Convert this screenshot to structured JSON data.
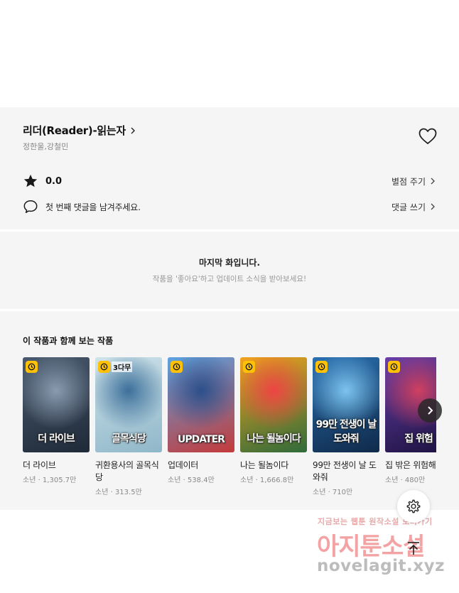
{
  "work": {
    "title": "리더(Reader)-읽는자",
    "authors": "정한울,강철민"
  },
  "rating": {
    "value": "0.0",
    "action_label": "별점 주기"
  },
  "comments": {
    "prompt": "첫 번째 댓글을 남겨주세요.",
    "action_label": "댓글 쓰기"
  },
  "notice": {
    "title": "마지막 화입니다.",
    "subtitle": "작품을 '좋아요'하고 업데이트 소식을 받아보세요!"
  },
  "recommendations": {
    "heading": "이 작품과 함께 보는 작품",
    "items": [
      {
        "name": "더 라이브",
        "meta": "소년 · 1,305.7만",
        "cover_text": "더 라이브",
        "badge": "",
        "colors": [
          "#4a5a6e",
          "#1f2a38",
          "#8a9bb0"
        ]
      },
      {
        "name": "귀환용사의 골목식당",
        "meta": "소년 · 313.5만",
        "cover_text": "골목식당",
        "badge": "3다무",
        "colors": [
          "#cfe3ea",
          "#8fb7c9",
          "#3c6f9a"
        ]
      },
      {
        "name": "업데이터",
        "meta": "소년 · 538.4만",
        "cover_text": "UPDATER",
        "badge": "",
        "colors": [
          "#5ba3e0",
          "#c43a3a",
          "#2c4f8a"
        ]
      },
      {
        "name": "나는 될놈이다",
        "meta": "소년 · 1,666.8만",
        "cover_text": "나는 될놈이다",
        "badge": "",
        "colors": [
          "#f3a21e",
          "#2f6b3a",
          "#e44"
        ]
      },
      {
        "name": "99만 전생이 날 도와줘",
        "meta": "소년 · 710만",
        "cover_text": "99만 전생이 날 도와줘",
        "badge": "",
        "colors": [
          "#2a6fb0",
          "#0f2a4a",
          "#7cc4f0"
        ]
      },
      {
        "name": "집 밖은 위험해",
        "meta": "소년 · 480만",
        "cover_text": "집 위험",
        "badge": "",
        "colors": [
          "#6a3fa8",
          "#1c1240",
          "#d04060"
        ]
      }
    ]
  },
  "icons": {
    "title_chevron": "chevron-right-icon",
    "favorite": "heart-outline-icon",
    "rating": "star-icon",
    "comment": "speech-bubble-icon",
    "wait_free": "clock-icon",
    "carousel_next": "chevron-right-icon",
    "settings": "gear-icon",
    "scroll_top": "arrow-up-icon"
  },
  "watermark": {
    "line1": "지금보는 웹툰 원작소설 보러가기",
    "line2": "아지툰소설",
    "line3": "novelagit.xyz"
  }
}
